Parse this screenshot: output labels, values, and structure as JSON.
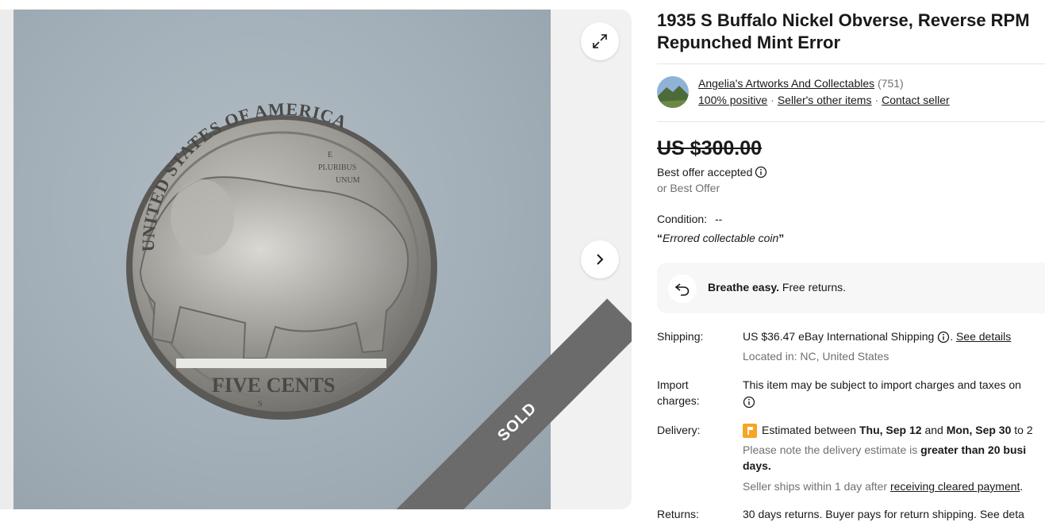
{
  "listing": {
    "title": "1935 S Buffalo Nickel Obverse, Reverse RPM Repunched Mint Error",
    "sold_banner": "SOLD"
  },
  "coin_image": {
    "top_legend": "UNITED STATES OF AMERICA",
    "mint_text_1": "E",
    "mint_text_2": "PLURIBUS",
    "mint_text_3": "UNUM",
    "bottom_legend": "FIVE CENTS",
    "mint_mark": "S"
  },
  "seller": {
    "name": "Angelia's Artworks And Collectables",
    "feedback_count": "(751)",
    "positive": "100% positive",
    "other_items": "Seller's other items",
    "contact": "Contact seller"
  },
  "price": {
    "original": "US $300.00",
    "offer_status": "Best offer accepted",
    "or_best_offer": "or Best Offer"
  },
  "condition": {
    "label": "Condition:",
    "value": "--",
    "quote_open": "“",
    "quote": "Errored collectable coin",
    "quote_close": "”"
  },
  "returns_banner": {
    "bold": "Breathe easy.",
    "text": "Free returns."
  },
  "shipping": {
    "label": "Shipping:",
    "cost": "US $36.47",
    "method": "eBay International Shipping",
    "period": ".",
    "details_link": "See details",
    "location": "Located in: NC, United States"
  },
  "import": {
    "label_1": "Import",
    "label_2": "charges:",
    "text": "This item may be subject to import charges and taxes on"
  },
  "delivery": {
    "label": "Delivery:",
    "estimate_prefix": "Estimated between",
    "date_from": "Thu, Sep 12",
    "and": "and",
    "date_to": "Mon, Sep 30",
    "suffix": "to 2",
    "note_prefix": "Please note the delivery estimate is",
    "note_bold": "greater than 20 busi",
    "note_bold_2": "days.",
    "ships_prefix": "Seller ships within 1 day after",
    "ships_link": "receiving cleared payment",
    "ships_suffix": "."
  },
  "returns_row": {
    "label": "Returns:",
    "text": "30 days returns. Buyer pays for return shipping. See deta"
  },
  "colors": {
    "accent_orange": "#f5a623",
    "sold_ribbon": "#6b6b6b",
    "text": "#191919",
    "muted": "#707070"
  },
  "icons": [
    "expand-icon",
    "chevron-right-icon",
    "info-icon",
    "return-arrow-icon",
    "delivery-flag-icon"
  ]
}
